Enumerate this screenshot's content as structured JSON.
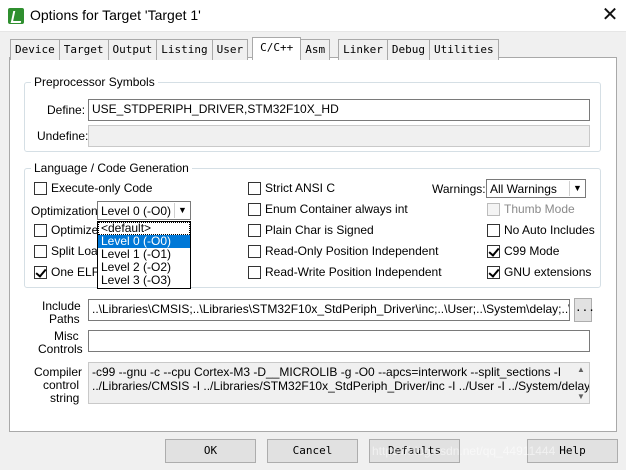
{
  "window": {
    "title": "Options for Target 'Target 1'",
    "close_glyph": "✕"
  },
  "tabs": [
    {
      "label": "Device"
    },
    {
      "label": "Target"
    },
    {
      "label": "Output"
    },
    {
      "label": "Listing"
    },
    {
      "label": "User"
    },
    {
      "label": "C/C++"
    },
    {
      "label": "Asm"
    },
    {
      "label": "Linker"
    },
    {
      "label": "Debug"
    },
    {
      "label": "Utilities"
    }
  ],
  "active_tab": "C/C++",
  "preprocessor": {
    "legend": "Preprocessor Symbols",
    "define_label": "Define:",
    "define_value": "USE_STDPERIPH_DRIVER,STM32F10X_HD",
    "undefine_label": "Undefine:",
    "undefine_value": ""
  },
  "language": {
    "legend": "Language / Code Generation",
    "execute_only": {
      "label": "Execute-only Code",
      "checked": false
    },
    "optimization_label": "Optimization:",
    "optimization_value": "Level 0 (-O0)",
    "optimization_options": [
      "<default>",
      "Level 0 (-O0)",
      "Level 1 (-O1)",
      "Level 2 (-O2)",
      "Level 3 (-O3)"
    ],
    "optimize_for_time": {
      "label": "Optimize f",
      "checked": false
    },
    "split_load": {
      "label": "Split Load",
      "checked": false
    },
    "one_elf": {
      "label": "One ELF",
      "checked": true
    },
    "strict_ansi": {
      "label": "Strict ANSI C",
      "checked": false
    },
    "enum_container": {
      "label": "Enum Container always int",
      "checked": false
    },
    "plain_char": {
      "label": "Plain Char is Signed",
      "checked": false
    },
    "ro_pi": {
      "label": "Read-Only Position Independent",
      "checked": false
    },
    "rw_pi": {
      "label": "Read-Write Position Independent",
      "checked": false
    },
    "warnings_label": "Warnings:",
    "warnings_value": "All Warnings",
    "thumb_mode": {
      "label": "Thumb Mode",
      "checked": false,
      "enabled": false
    },
    "no_auto_includes": {
      "label": "No Auto Includes",
      "checked": false
    },
    "c99_mode": {
      "label": "C99 Mode",
      "checked": true
    },
    "gnu_extensions": {
      "label": "GNU extensions",
      "checked": true
    }
  },
  "include_paths": {
    "label_line1": "Include",
    "label_line2": "Paths",
    "value": "..\\Libraries\\CMSIS;..\\Libraries\\STM32F10x_StdPeriph_Driver\\inc;..\\User;..\\System\\delay;..\\System\\",
    "browse_label": "..."
  },
  "misc_controls": {
    "label_line1": "Misc",
    "label_line2": "Controls",
    "value": ""
  },
  "compiler_string": {
    "label_line1": "Compiler",
    "label_line2": "control",
    "label_line3": "string",
    "line1": "-c99 --gnu -c --cpu Cortex-M3 -D__MICROLIB -g -O0 --apcs=interwork --split_sections -I",
    "line2": "../Libraries/CMSIS -I ../Libraries/STM32F10x_StdPeriph_Driver/inc -I ../User -I ../System/delay -I"
  },
  "buttons": {
    "ok": "OK",
    "cancel": "Cancel",
    "defaults": "Defaults",
    "help": "Help"
  },
  "watermark": "https://blog.csdn.net/qq_44911444",
  "colors": {
    "selection": "#0078d7",
    "app_icon": "#2f8f2f"
  }
}
